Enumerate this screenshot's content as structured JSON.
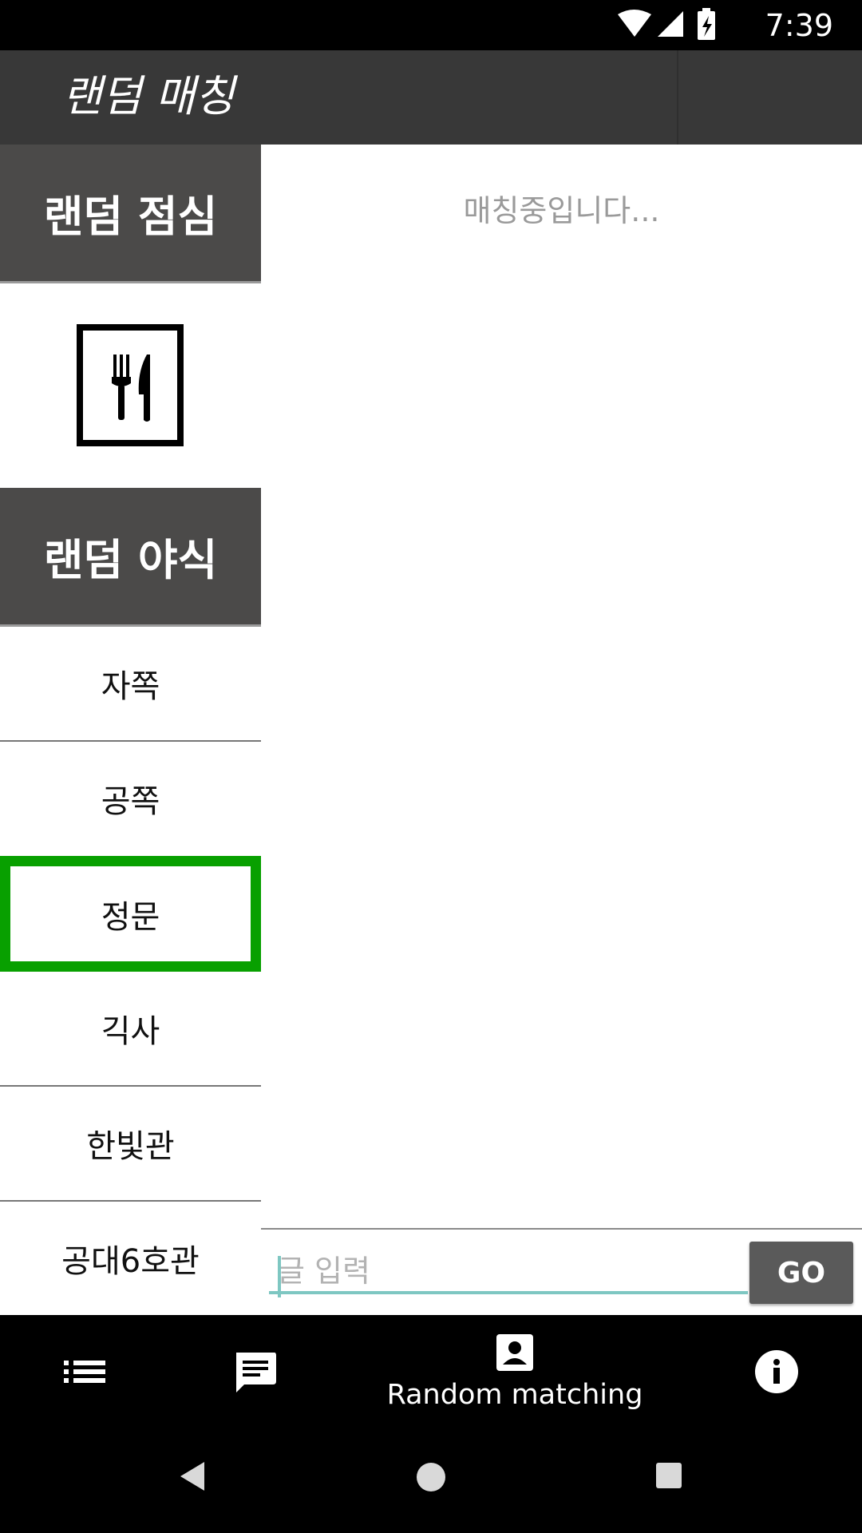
{
  "status_bar": {
    "time": "7:39"
  },
  "app_bar": {
    "title": "랜덤 매칭"
  },
  "left_panel": {
    "lunch_header": "랜덤 점심",
    "late_snack_header": "랜덤 야식",
    "locations": [
      "자쪽",
      "공쪽",
      "정문",
      "긱사",
      "한빛관",
      "공대6호관"
    ],
    "selected_location": "정문"
  },
  "main": {
    "status_message": "매칭중입니다...",
    "input_placeholder": "글 입력",
    "go_label": "GO"
  },
  "bottom_nav": {
    "items": [
      {
        "icon": "list-icon",
        "label": ""
      },
      {
        "icon": "chat-icon",
        "label": ""
      },
      {
        "icon": "account-box-icon",
        "label": "Random matching"
      },
      {
        "icon": "info-icon",
        "label": ""
      }
    ],
    "active": "Random matching"
  },
  "system_nav": {
    "icons": [
      "back-icon",
      "home-icon",
      "recents-icon"
    ]
  },
  "colors": {
    "app_bar": "#383838",
    "section_header": "#4b4a49",
    "selected_border": "#08a000",
    "input_underline": "#7ec7c2",
    "go_button": "#5a5a5a"
  }
}
